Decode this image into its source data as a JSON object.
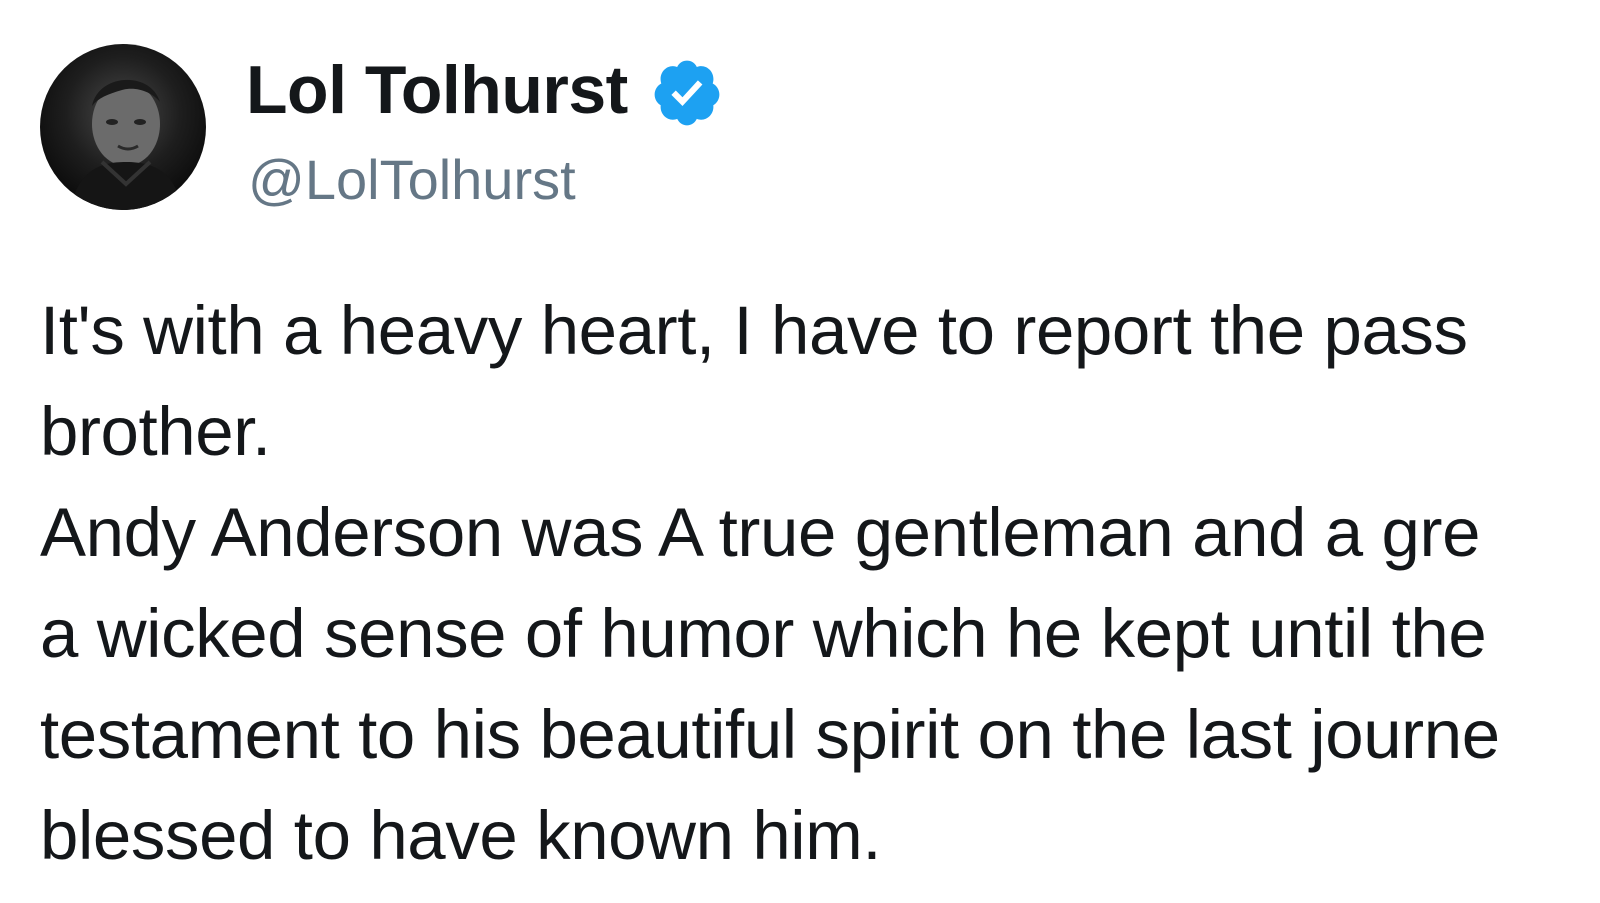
{
  "tweet": {
    "author": {
      "display_name": "Lol Tolhurst",
      "handle": "@LolTolhurst",
      "verified": true,
      "avatar_icon": "profile-photo",
      "verified_icon": "verified-badge-icon"
    },
    "text_lines": [
      "It's with a heavy heart, I have to report the pass",
      "brother.",
      "Andy Anderson was A true gentleman and a gre",
      "a wicked sense of humor which he kept until the",
      "testament to his beautiful spirit on the last journe",
      "blessed to have known him."
    ]
  },
  "colors": {
    "text": "#14171a",
    "handle": "#657786",
    "verified_blue": "#1da1f2",
    "background": "#ffffff"
  }
}
